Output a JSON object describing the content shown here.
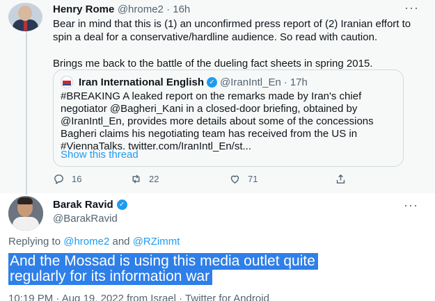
{
  "tweet1": {
    "author_name": "Henry Rome",
    "handle": "@hrome2",
    "time": "16h",
    "paragraph1": "Bear in mind that this is (1) an unconfirmed press report of (2) Iranian effort to spin a deal for a conservative/hardline audience. So read with caution.",
    "paragraph2": "Brings me back to the battle of the dueling fact sheets in spring 2015.",
    "quote": {
      "author_name": "Iran International English",
      "handle": "@IranIntl_En",
      "time": "17h",
      "text": "#BREAKING A leaked report on the remarks made by Iran's chief negotiator @Bagheri_Kani in a closed-door briefing, obtained by @IranIntl_En, provides more details about some of the concessions Bagheri claims his negotiating team has received from the US in #ViennaTalks. twitter.com/IranIntl_En/st...",
      "show_thread": "Show this thread"
    },
    "actions": {
      "replies": "16",
      "retweets": "22",
      "likes": "71"
    }
  },
  "tweet2": {
    "author_name": "Barak Ravid",
    "handle": "@BarakRavid",
    "replying_prefix": "Replying to",
    "replying_to_1": "@hrome2",
    "replying_and": "and",
    "replying_to_2": "@RZimmt",
    "text_line1": "And the Mossad is using this media outlet quite",
    "text_line2": "regularly for its information war",
    "meta": "10:19 PM · Aug 19, 2022 from Israel · Twitter for Android"
  },
  "icons": [
    "more-icon",
    "verified-badge-icon",
    "reply-icon",
    "retweet-icon",
    "like-icon",
    "share-icon"
  ],
  "colors": {
    "accent": "#1d9bf0",
    "highlight": "#2f7fe8",
    "muted": "#536471"
  }
}
